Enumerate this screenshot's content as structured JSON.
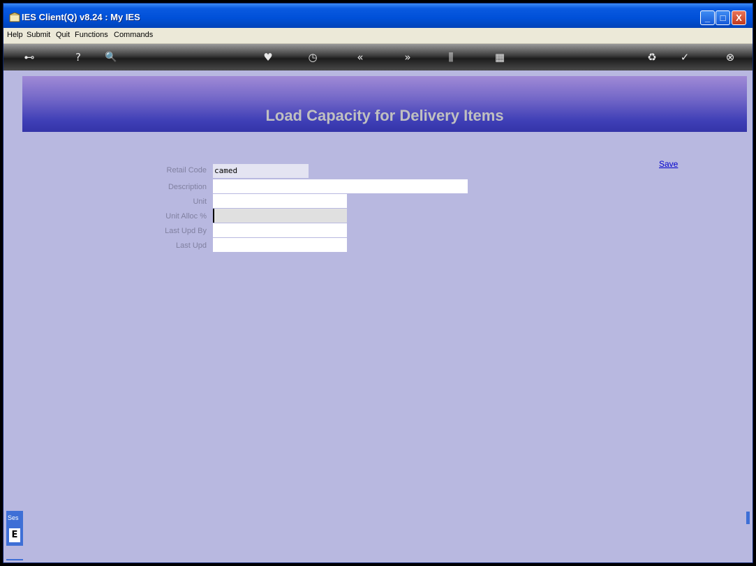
{
  "window": {
    "title": "IES Client(Q) v8.24 : My IES",
    "min_symbol": "_",
    "max_symbol": "□",
    "close_symbol": "X"
  },
  "menu": [
    "Help",
    "Submit",
    "Quit",
    "Functions",
    "Commands"
  ],
  "toolbar": {
    "icons": [
      "key-icon",
      "help-icon",
      "search-icon",
      "heart-icon",
      "clock-icon",
      "back-icon",
      "forward-icon",
      "tools-icon",
      "grid-icon",
      "recycle-icon",
      "check-icon",
      "close-icon"
    ],
    "glyphs": {
      "key": "⊷",
      "help": "?",
      "search": "🔍",
      "heart": "♥",
      "clock": "◷",
      "back": "«",
      "forward": "»",
      "tools": "⫼",
      "grid": "▦",
      "recycle": "♻",
      "check": "✓",
      "close": "⊗"
    }
  },
  "banner": {
    "title": "Load Capacity for Delivery Items"
  },
  "actions": {
    "save": "Save"
  },
  "form": {
    "retail_code_label": "Retail Code",
    "retail_code_value": "camed",
    "description_label": "Description",
    "description_value": "",
    "unit_label": "Unit",
    "unit_value": "",
    "unit_alloc_label": "Unit Alloc %",
    "unit_alloc_value": "",
    "last_upd_by_label": "Last Upd By",
    "last_upd_by_value": "",
    "last_upd_label": "Last Upd",
    "last_upd_value": ""
  },
  "side_tab": {
    "label": "Ses",
    "glyph": "E"
  },
  "colors": {
    "background": "#b8b8e0",
    "banner_title": "#c0c0c0",
    "link": "#0000cc"
  }
}
